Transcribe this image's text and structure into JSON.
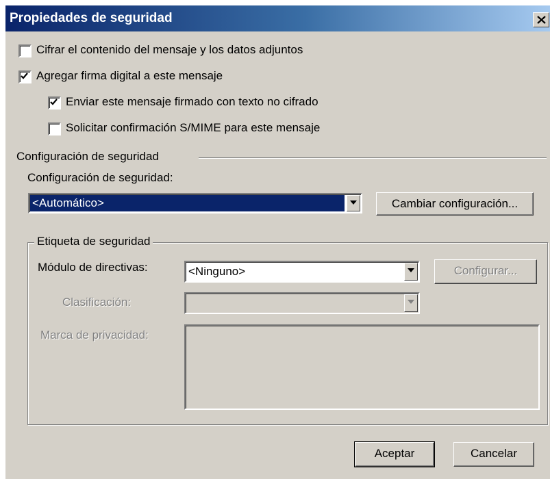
{
  "window": {
    "title": "Propiedades de seguridad"
  },
  "options": [
    {
      "label": "Cifrar el contenido del mensaje y los datos adjuntos",
      "checked": false
    },
    {
      "label": "Agregar firma digital a este mensaje",
      "checked": true
    },
    {
      "label": "Enviar este mensaje firmado con texto no cifrado",
      "checked": true
    },
    {
      "label": "Solicitar confirmación S/MIME para este mensaje",
      "checked": false
    }
  ],
  "security_config": {
    "section_title": "Configuración de seguridad",
    "field_label": "Configuración de seguridad:",
    "selected": "<Automático>",
    "change_button": "Cambiar configuración..."
  },
  "security_label": {
    "group_title": "Etiqueta de seguridad",
    "policy_module_label": "Módulo de directivas:",
    "policy_module_value": "<Ninguno>",
    "configure_button": "Configurar...",
    "classification_label": "Clasificación:",
    "classification_value": "",
    "privacy_mark_label": "Marca de privacidad:",
    "privacy_mark_value": ""
  },
  "footer": {
    "ok_button": "Aceptar",
    "cancel_button": "Cancelar"
  },
  "colors": {
    "dialog_bg": "#d4d0c8",
    "titlebar_start": "#0a246a",
    "titlebar_end": "#a6caf0",
    "selection": "#0a246a"
  },
  "icons": {
    "close": "close-icon",
    "check": "checkmark-icon",
    "dropdown": "chevron-down-icon"
  }
}
